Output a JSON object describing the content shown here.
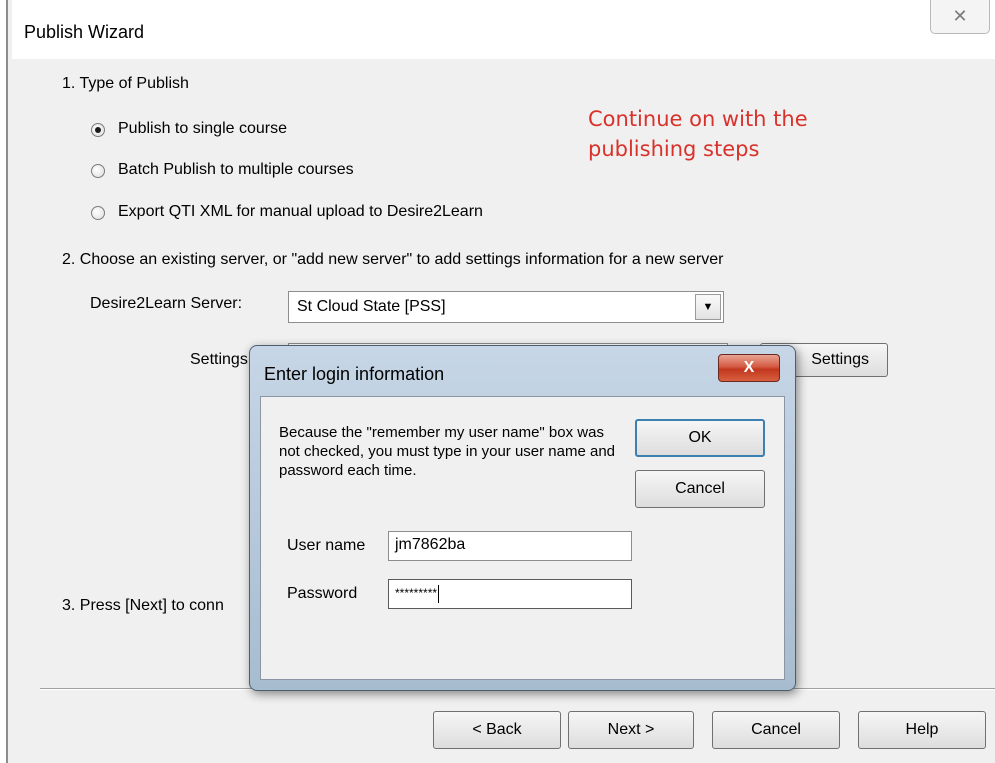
{
  "window": {
    "title": "Publish Wizard",
    "close_glyph": "✕"
  },
  "section1": {
    "heading": "1. Type of Publish",
    "options": [
      {
        "label": "Publish to single course",
        "checked": true
      },
      {
        "label": "Batch Publish to multiple courses",
        "checked": false
      },
      {
        "label": "Export QTI XML for manual upload to Desire2Learn",
        "checked": false
      }
    ]
  },
  "annotation": {
    "line1": "Continue on with the",
    "line2": "publishing steps",
    "color": "#d9312b"
  },
  "section2": {
    "heading": "2. Choose an existing server, or \"add new server\" to add settings information for a new server",
    "server_label": "Desire2Learn Server:",
    "server_value": "St Cloud State [PSS]",
    "settings_label": "Settings",
    "settings_button_label": "Settings"
  },
  "section3": {
    "heading": "3. Press [Next] to conn"
  },
  "footer": {
    "back_label": "< Back",
    "next_label": "Next >",
    "cancel_label": "Cancel",
    "help_label": "Help"
  },
  "login_dialog": {
    "title": "Enter login information",
    "close_glyph": "X",
    "message": "Because the \"remember my user name\" box was not checked, you must type in your user name and password each time.",
    "ok_label": "OK",
    "cancel_label": "Cancel",
    "username_label": "User name",
    "username_value": "jm7862ba",
    "password_label": "Password",
    "password_value": "*********"
  }
}
